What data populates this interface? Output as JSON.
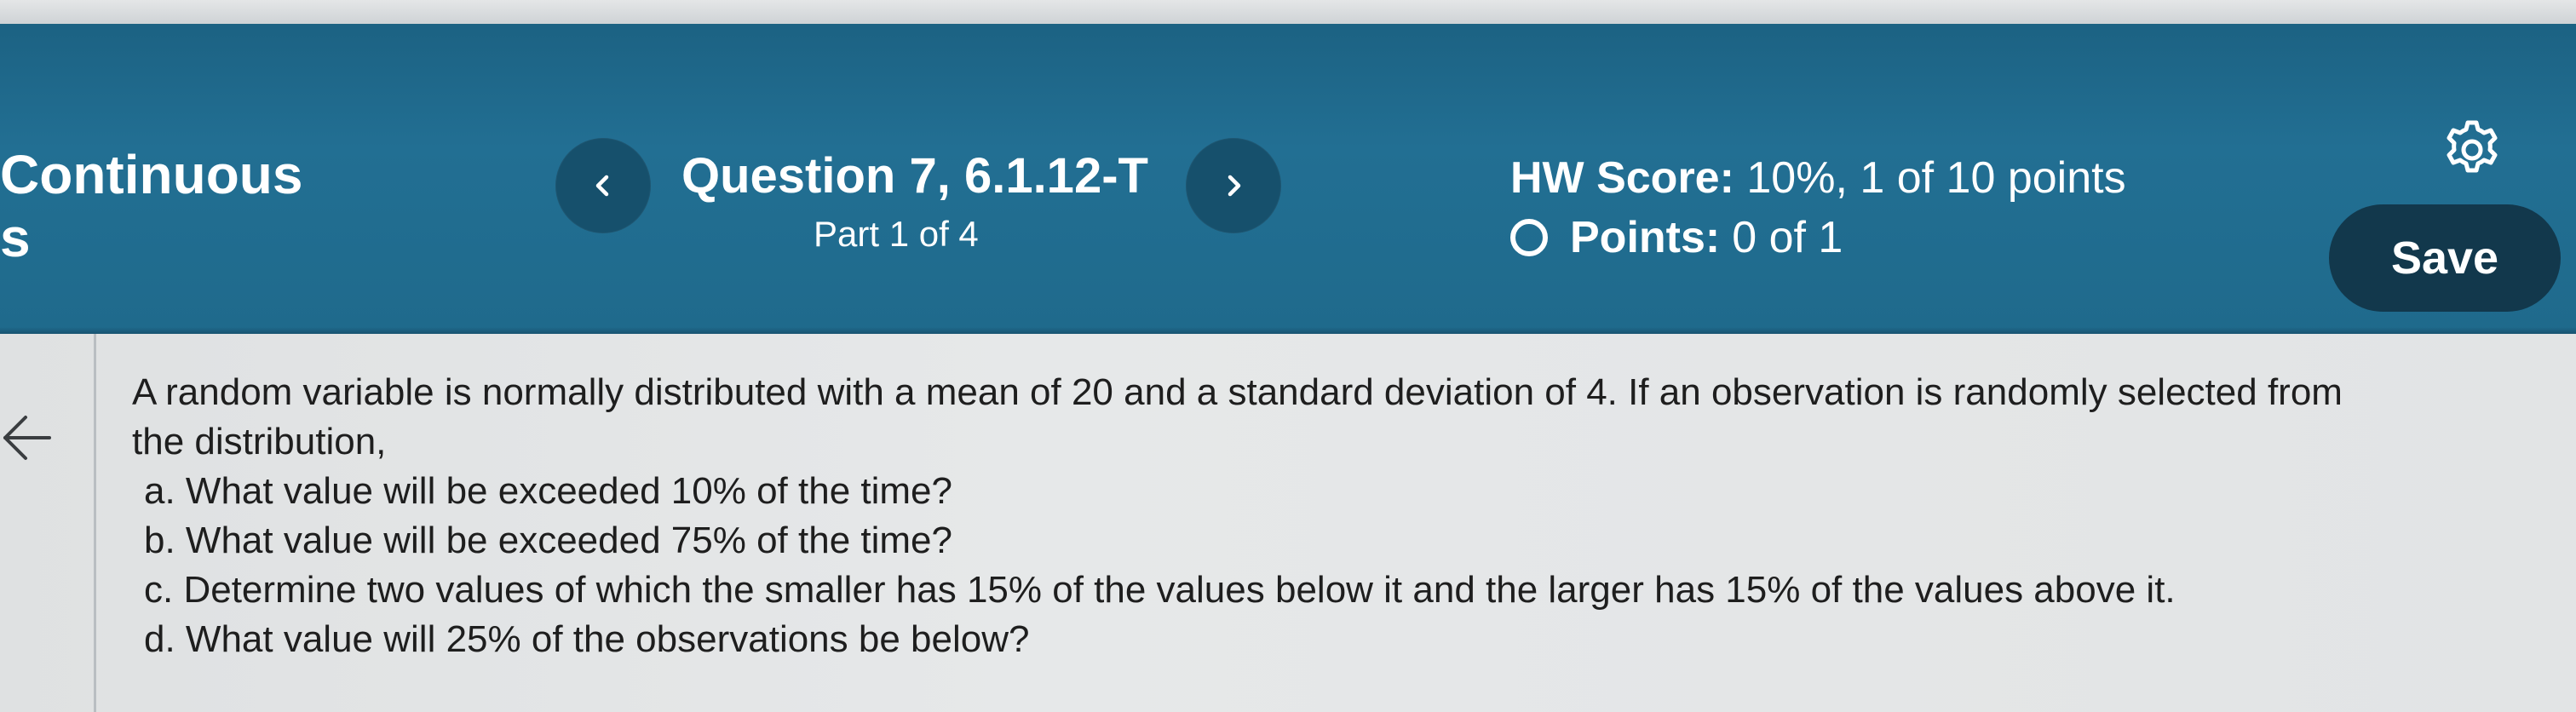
{
  "assignment": {
    "title_line1": "Continuous",
    "title_line2": "s"
  },
  "question": {
    "title": "Question 7, 6.1.12-T",
    "part": "Part 1 of 4"
  },
  "score": {
    "hw_label": "HW Score:",
    "hw_value": "10%, 1 of 10 points",
    "points_label": "Points:",
    "points_value": "0 of 1"
  },
  "toolbar": {
    "save_label": "Save",
    "settings_icon": "gear-icon",
    "prev_icon": "chevron-left-icon",
    "next_icon": "chevron-right-icon",
    "back_icon": "arrow-left-icon"
  },
  "problem": {
    "intro_line1": "A random variable is normally distributed with a mean of 20 and a standard deviation of 4. If an observation is randomly selected from",
    "intro_line2": "the distribution,",
    "items": [
      "a. What value will be exceeded 10% of the time?",
      "b. What value will be exceeded 75% of the time?",
      "c. Determine two values of which the smaller has 15% of the values below it and the larger has 15% of the values above it.",
      "d. What value will 25% of the observations be below?"
    ]
  },
  "colors": {
    "header_bg": "#1f6a8c",
    "nav_button_bg": "#16506c",
    "save_button_bg": "#12384c",
    "content_bg": "#e4e6e7"
  }
}
